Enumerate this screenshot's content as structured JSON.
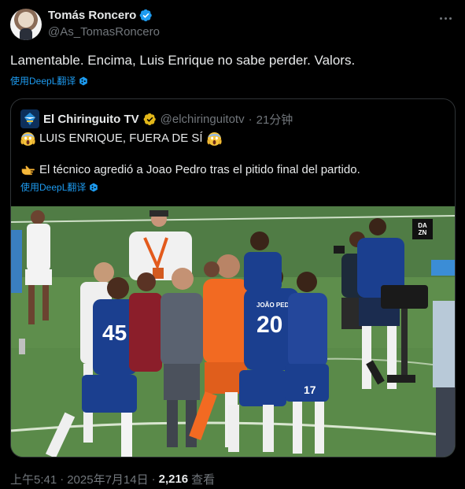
{
  "author": {
    "name": "Tomás Roncero",
    "handle": "@As_TomasRoncero"
  },
  "tweet": {
    "text": "Lamentable. Encima, Luis Enrique no sabe perder. Valors.",
    "translate_label": "使用DeepL翻译"
  },
  "quote": {
    "name": "El Chiringuito TV",
    "handle": "@elchiringuitotv",
    "separator": "·",
    "time": "21分钟",
    "line1": "LUIS ENRIQUE, FUERA DE SÍ",
    "line2": "El técnico agredió a Joao Pedro tras el pitido final del partido.",
    "translate_label": "使用DeepL翻译",
    "media": {
      "watermark_line1": "DA",
      "watermark_line2": "ZN",
      "jersey_numbers": [
        "45",
        "20",
        "17"
      ],
      "jersey_name": "JOÃO PEDRO"
    }
  },
  "footer": {
    "time": "上午5:41",
    "separator": "·",
    "date": "2025年7月14日",
    "separator2": "·",
    "views": "2,216",
    "views_label": "查看"
  },
  "colors": {
    "background": "#000000",
    "text": "#e7e9ea",
    "secondary": "#71767b",
    "link": "#1d9bf0",
    "verified_blue": "#1d9bf0",
    "verified_gold": "#e2b719",
    "border": "#2f3336",
    "chelsea_blue": "#1b3f8f",
    "keeper_orange": "#f26a22",
    "pitch_green": "#5c8a4b"
  },
  "icons": {
    "verified": "verified-badge-icon",
    "more": "more-options-icon",
    "translate": "deepl-icon",
    "scream": "scream-emoji-icon",
    "point": "pointing-right-emoji-icon"
  }
}
